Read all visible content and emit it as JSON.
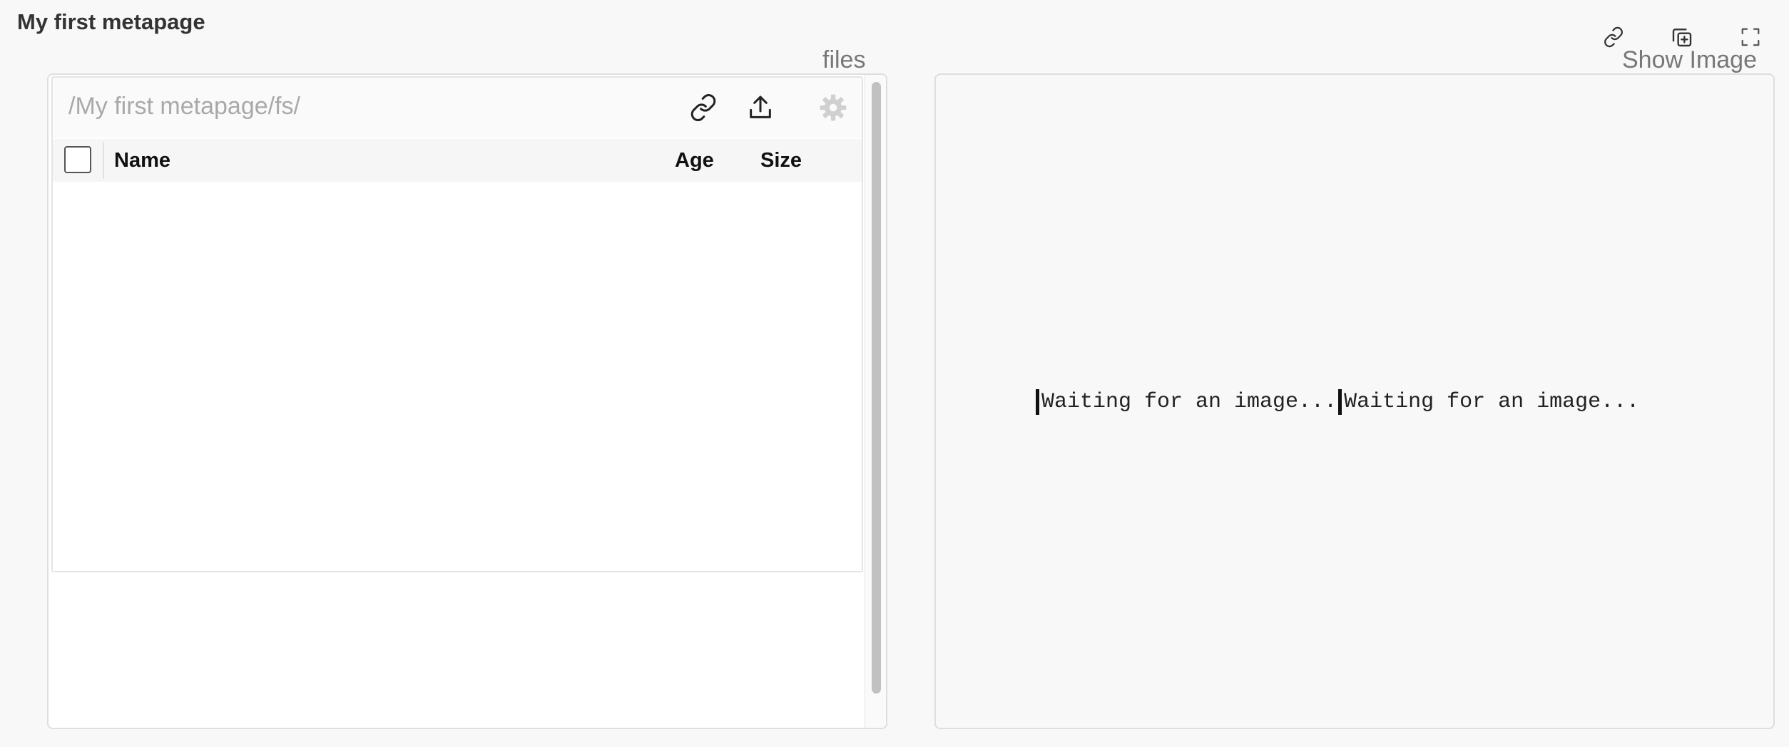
{
  "app": {
    "title": "My first metapage"
  },
  "toolbar": {
    "icons": [
      "link-icon",
      "add-copy-icon",
      "fullscreen-icon"
    ]
  },
  "files_panel": {
    "label": "files",
    "path": "/My first metapage/fs/",
    "tool_icons": [
      "link-icon",
      "upload-icon",
      "gear-icon"
    ],
    "columns": [
      "Name",
      "Age",
      "Size"
    ],
    "rows": []
  },
  "image_panel": {
    "label": "Show Image",
    "messages": [
      "Waiting for an image...",
      "Waiting for an image..."
    ]
  },
  "colors": {
    "background": "#f8f8f8",
    "panel_border": "#dedede",
    "muted_text": "#a9a9a9"
  }
}
